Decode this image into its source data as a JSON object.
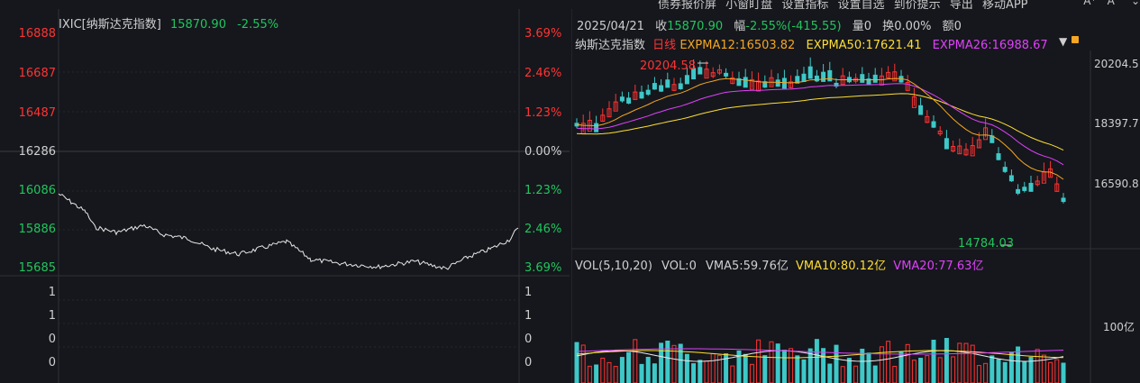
{
  "top_menu": [
    "债券报价屏",
    "小窗盯盘",
    "设置指标",
    "设置自选",
    "到价提示",
    "导出",
    "移动APP"
  ],
  "font_controls": [
    "A⁺",
    "A⁻",
    "⌄"
  ],
  "intraday": {
    "symbol": "IXIC[纳斯达克指数]",
    "last": "15870.90",
    "change_pct": "-2.55%",
    "price_labels": [
      "16888",
      "16687",
      "16487",
      "16286",
      "16086",
      "15886",
      "15685"
    ],
    "pct_labels": [
      "3.69%",
      "2.46%",
      "1.23%",
      "0.00%",
      "1.23%",
      "2.46%",
      "3.69%"
    ],
    "volume_labels": [
      "1",
      "1",
      "0",
      "0"
    ],
    "volume_labels_right": [
      "1",
      "1",
      "0",
      "0"
    ]
  },
  "kline": {
    "date": "2025/04/21",
    "close_label": "收",
    "close": "15870.90",
    "range_label": "幅",
    "range": "-2.55%(-415.55)",
    "vol_label": "量",
    "vol": "0",
    "turnover_label": "换",
    "turnover": "0.00%",
    "amount_label": "额",
    "amount": "0",
    "index_name": "纳斯达克指数",
    "period": "日线",
    "ema12": "EXPMA12:16503.82",
    "ema50": "EXPMA50:17621.41",
    "ema26": "EXPMA26:16988.67",
    "high_marker": "20204.58",
    "low_marker": "14784.03",
    "axis_labels": [
      "20204.5",
      "18397.7",
      "16590.8"
    ],
    "vol_header": "VOL(5,10,20)",
    "vol_value": "VOL:0",
    "vma5": "VMA5:59.76亿",
    "vma10": "VMA10:80.12亿",
    "vma20": "VMA20:77.63亿",
    "vol_axis_label": "100亿"
  },
  "colors": {
    "up": "#ff3333",
    "down": "#22c55e",
    "bar_down": "#3ec8c8",
    "ema12": "#f5a623",
    "ema50": "#ffdd33",
    "ema26": "#e040fb",
    "bg": "#15171c"
  }
}
